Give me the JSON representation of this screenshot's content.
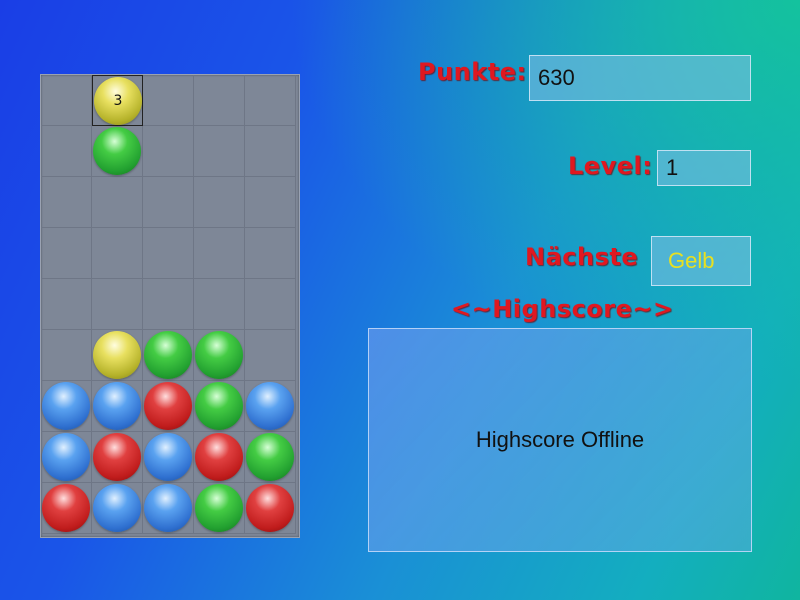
{
  "labels": {
    "score": "Punkte:",
    "level": "Level:",
    "next": "Nächste",
    "highscore": "<~Highscore~>"
  },
  "values": {
    "score": "630",
    "level": "1",
    "next": "Gelb"
  },
  "highscore_status": "Highscore Offline",
  "colors": {
    "label": "#e01820",
    "next_value": "#e8e020",
    "yellow": "#d0cc3a",
    "green": "#2fb03a",
    "blue": "#3a82e0",
    "red": "#d02828"
  },
  "board": {
    "columns": 5,
    "rows": 9,
    "grid": [
      [
        "",
        "yellow",
        "",
        "",
        ""
      ],
      [
        "",
        "green",
        "",
        "",
        ""
      ],
      [
        "",
        "",
        "",
        "",
        ""
      ],
      [
        "",
        "",
        "",
        "",
        ""
      ],
      [
        "",
        "",
        "",
        "",
        ""
      ],
      [
        "",
        "yellow",
        "green",
        "green",
        ""
      ],
      [
        "blue",
        "blue",
        "red",
        "green",
        "blue"
      ],
      [
        "blue",
        "red",
        "blue",
        "red",
        "green"
      ],
      [
        "red",
        "blue",
        "blue",
        "green",
        "red"
      ]
    ],
    "selected": {
      "row": 0,
      "col": 1,
      "counter": "3"
    }
  }
}
